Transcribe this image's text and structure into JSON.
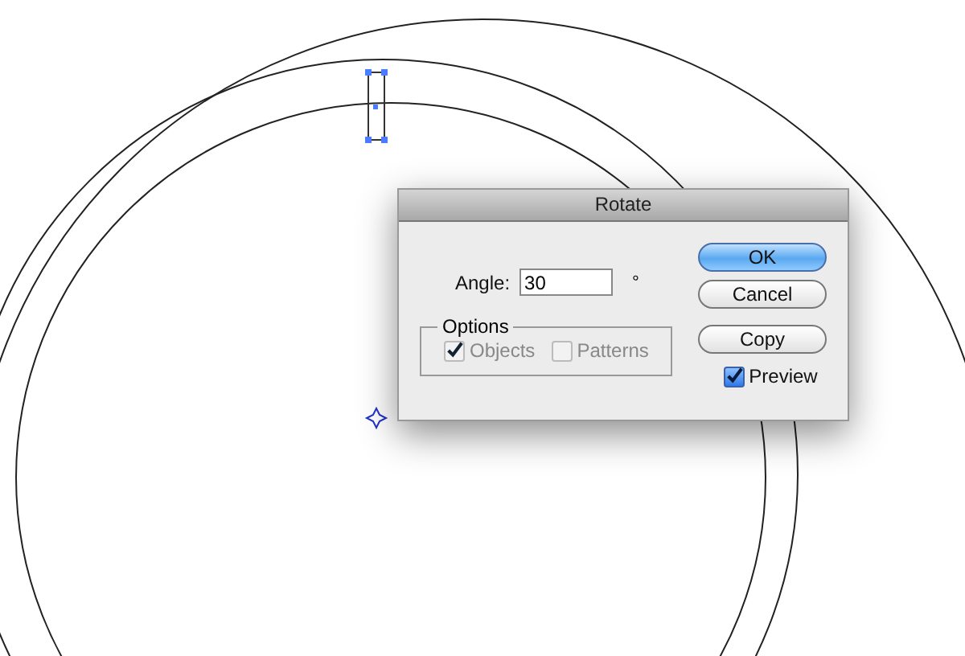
{
  "dialog": {
    "title": "Rotate",
    "angle": {
      "label": "Angle:",
      "value": "30",
      "unit": "°"
    },
    "options": {
      "legend": "Options",
      "checkboxes": [
        {
          "label": "Objects",
          "checked": true,
          "disabled": true
        },
        {
          "label": "Patterns",
          "checked": false,
          "disabled": true
        }
      ]
    },
    "buttons": [
      {
        "label": "OK",
        "kind": "default"
      },
      {
        "label": "Cancel",
        "kind": "normal"
      },
      {
        "label": "Copy",
        "kind": "normal"
      }
    ],
    "preview": {
      "label": "Preview",
      "checked": true,
      "disabled": false
    }
  }
}
